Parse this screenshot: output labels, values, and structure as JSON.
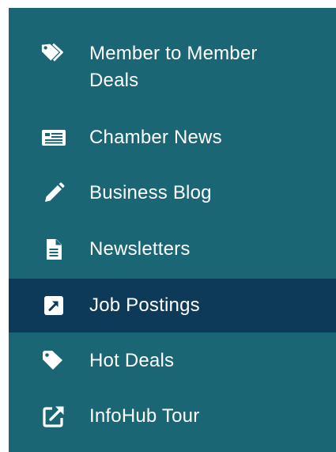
{
  "colors": {
    "menu_background": "#1a6674",
    "active_background": "#0d3a59",
    "text": "#ffffff"
  },
  "menu": {
    "items": [
      {
        "label_line1": "Member to Member",
        "label_line2": "Deals",
        "icon": "tags-icon",
        "active": false
      },
      {
        "label": "Chamber News",
        "icon": "newspaper-icon",
        "active": false
      },
      {
        "label": "Business Blog",
        "icon": "pencil-icon",
        "active": false
      },
      {
        "label": "Newsletters",
        "icon": "document-icon",
        "active": false
      },
      {
        "label": "Job Postings",
        "icon": "external-link-square-icon",
        "active": true
      },
      {
        "label": "Hot Deals",
        "icon": "tag-icon",
        "active": false
      },
      {
        "label": "InfoHub Tour",
        "icon": "external-link-icon",
        "active": false
      }
    ]
  }
}
